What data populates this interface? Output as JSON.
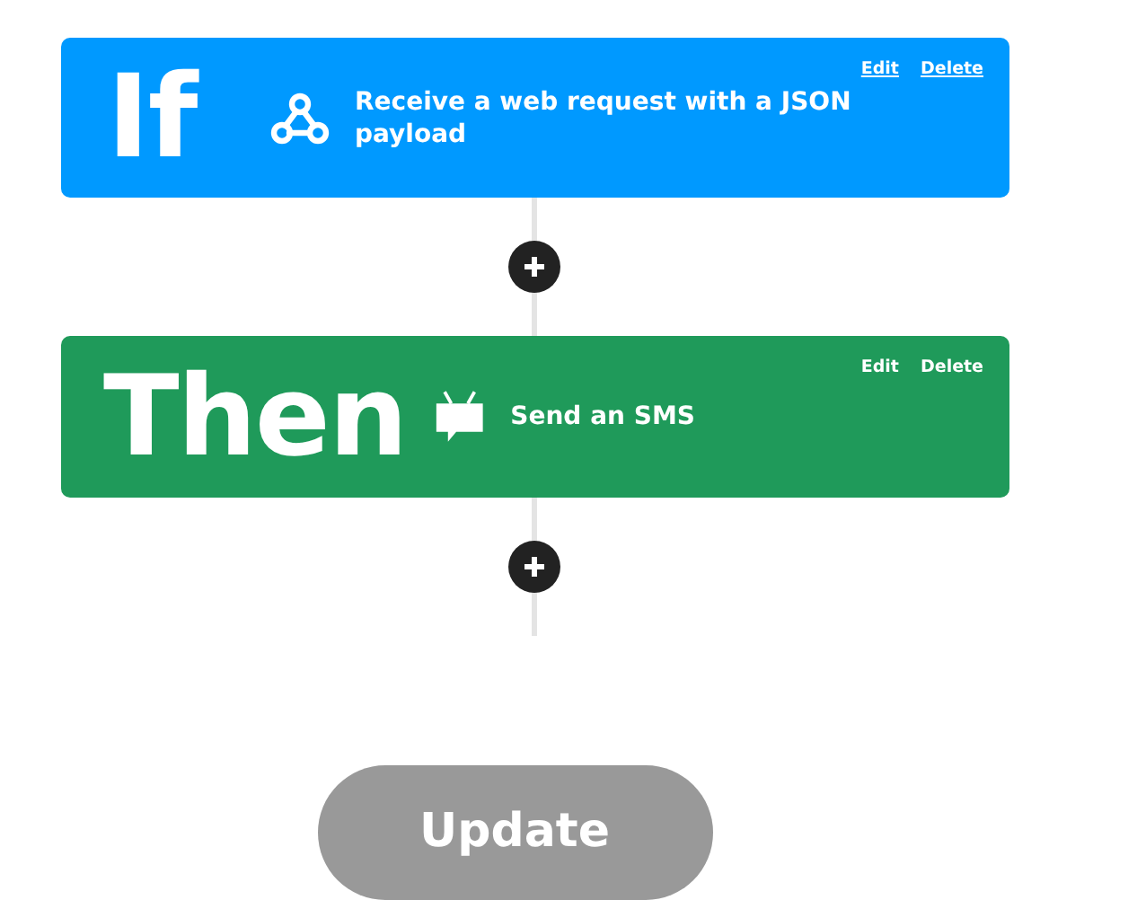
{
  "steps": [
    {
      "kind": "trigger",
      "keyword": "If",
      "description": "Receive a web request with a JSON payload",
      "links": [
        {
          "label": "Edit",
          "underlined": true
        },
        {
          "label": "Delete",
          "underlined": true
        }
      ]
    },
    {
      "kind": "action",
      "keyword": "Then",
      "description": "Send an SMS",
      "links": [
        {
          "label": "Edit",
          "underlined": false
        },
        {
          "label": "Delete",
          "underlined": false
        }
      ]
    }
  ],
  "update_button": {
    "label": "Update",
    "disabled": true
  }
}
